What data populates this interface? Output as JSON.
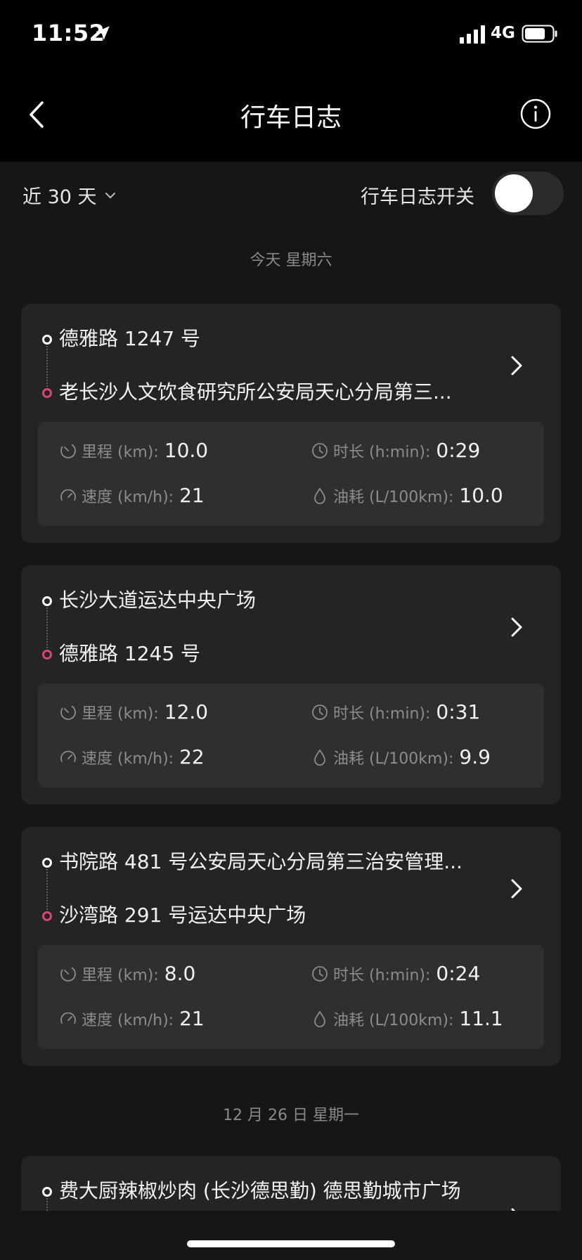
{
  "status_bar": {
    "time": "11:52",
    "network": "4G",
    "icons": [
      "location-arrow-icon",
      "signal-icon",
      "battery-icon"
    ]
  },
  "nav": {
    "title": "行车日志",
    "back_icon": "chevron-left-icon",
    "info_icon": "info-circle-icon"
  },
  "filter": {
    "range_label": "近 30 天",
    "toggle_label": "行车日志开关",
    "toggle_on": false
  },
  "groups": [
    {
      "date": "今天 星期六",
      "trips": [
        {
          "start": "德雅路 1247 号",
          "end": "老长沙人文饮食研究所公安局天心分局第三...",
          "distance_label": "里程 (km):",
          "distance": "10.0",
          "duration_label": "时长 (h:min):",
          "duration": "0:29",
          "speed_label": "速度 (km/h):",
          "speed": "21",
          "fuel_label": "油耗 (L/100km):",
          "fuel": "10.0"
        },
        {
          "start": "长沙大道运达中央广场",
          "end": "德雅路 1245 号",
          "distance_label": "里程 (km):",
          "distance": "12.0",
          "duration_label": "时长 (h:min):",
          "duration": "0:31",
          "speed_label": "速度 (km/h):",
          "speed": "22",
          "fuel_label": "油耗 (L/100km):",
          "fuel": "9.9"
        },
        {
          "start": "书院路 481 号公安局天心分局第三治安管理...",
          "end": "沙湾路 291 号运达中央广场",
          "distance_label": "里程 (km):",
          "distance": "8.0",
          "duration_label": "时长 (h:min):",
          "duration": "0:24",
          "speed_label": "速度 (km/h):",
          "speed": "21",
          "fuel_label": "油耗 (L/100km):",
          "fuel": "11.1"
        }
      ]
    },
    {
      "date": "12 月 26 日 星期一",
      "trips": [
        {
          "start": "费大厨辣椒炒肉 (长沙德思勤) 德思勤城市广场"
        }
      ]
    }
  ],
  "colors": {
    "background": "#161616",
    "card": "#242424",
    "stats_panel": "#2f2f2f",
    "end_dot": "#d8457a",
    "muted_text": "#8c8c8c"
  }
}
